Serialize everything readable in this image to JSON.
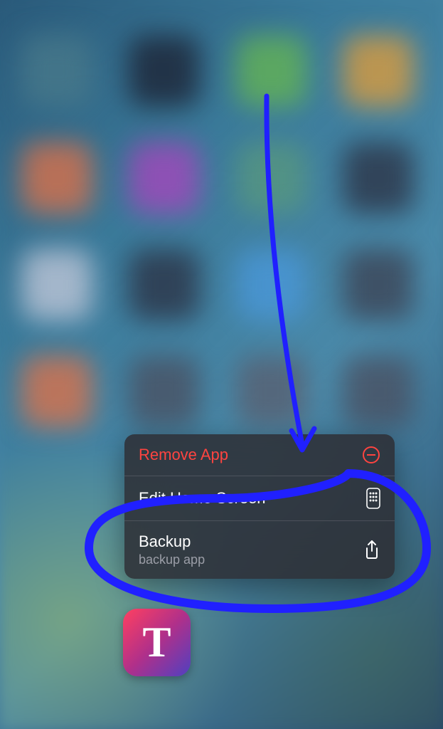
{
  "context_menu": {
    "items": [
      {
        "label": "Remove App",
        "icon": "minus-circle"
      },
      {
        "label": "Edit Home Screen",
        "icon": "apps-grid"
      },
      {
        "label": "Backup",
        "sublabel": "backup app",
        "icon": "share"
      }
    ]
  },
  "app": {
    "letter": "T"
  },
  "colors": {
    "destructive": "#ff4440",
    "annotation": "#2020ff"
  }
}
